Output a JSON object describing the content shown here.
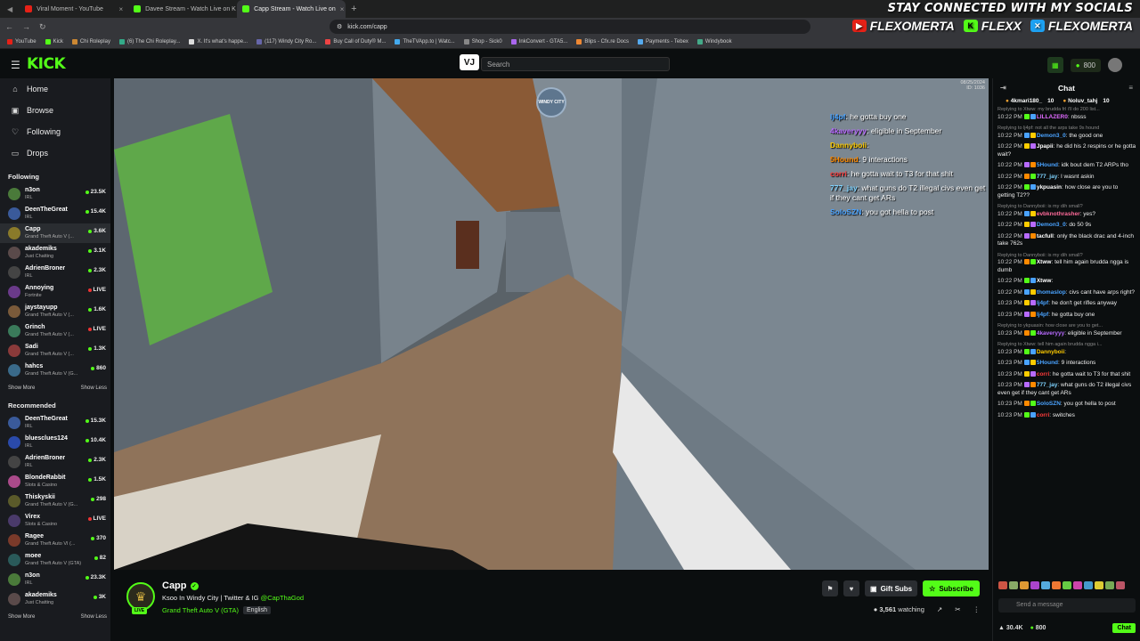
{
  "browser": {
    "tabs": [
      {
        "title": "Viral Moment - YouTube",
        "color": "#e62117"
      },
      {
        "title": "Davee Stream - Watch Live on K",
        "color": "#53fc18"
      },
      {
        "title": "Capp Stream - Watch Live on",
        "color": "#53fc18",
        "active": true
      }
    ],
    "url": "kick.com/capp",
    "bookmarks": [
      "YouTube",
      "Kick",
      "Chi Roleplay",
      "(6) The Chi Roleplay...",
      "X. It's what's happe...",
      "(117) Windy City Ro...",
      "Buy Call of Duty® M...",
      "TheTVApp.to | Watc...",
      "Shop - Sick0",
      "InkConvert - GTA5...",
      "Blips - Cfx.re Docs",
      "Payments - Tebex",
      "Windybook"
    ]
  },
  "socials_overlay": {
    "heading": "STAY CONNECTED WITH MY SOCIALS",
    "items": [
      {
        "icon": "youtube-icon",
        "handle": "FLEXOMERTA",
        "color": "#e62117"
      },
      {
        "icon": "kick-icon",
        "handle": "FLEXX",
        "color": "#53fc18"
      },
      {
        "icon": "twitter-icon",
        "handle": "FLEXOMERTA",
        "color": "#1da1f2"
      }
    ]
  },
  "kick": {
    "logo": "KICK",
    "search_placeholder": "Search",
    "vj_label": "VJ",
    "points": "800",
    "nav": [
      {
        "label": "Home",
        "icon": "home-icon"
      },
      {
        "label": "Browse",
        "icon": "browse-icon"
      },
      {
        "label": "Following",
        "icon": "heart-icon"
      },
      {
        "label": "Drops",
        "icon": "drops-icon"
      }
    ],
    "following_title": "Following",
    "following": [
      {
        "name": "n3on",
        "game": "IRL",
        "viewers": "23.5K",
        "color": "#4a7a3a"
      },
      {
        "name": "DeenTheGreat",
        "game": "IRL",
        "viewers": "15.4K",
        "color": "#3a5a9a"
      },
      {
        "name": "Capp",
        "game": "Grand Theft Auto V (...",
        "viewers": "3.6K",
        "color": "#8a7a2a",
        "active": true
      },
      {
        "name": "akademiks",
        "game": "Just Chatting",
        "viewers": "3.1K",
        "color": "#5a4a4a"
      },
      {
        "name": "AdrienBroner",
        "game": "IRL",
        "viewers": "2.3K",
        "color": "#444"
      },
      {
        "name": "Annoying",
        "game": "Fortnite",
        "viewers": "LIVE",
        "color": "#6a3a8a"
      },
      {
        "name": "jaystayupp",
        "game": "Grand Theft Auto V (...",
        "viewers": "1.6K",
        "color": "#7a5a3a"
      },
      {
        "name": "Grinch",
        "game": "Grand Theft Auto V (...",
        "viewers": "LIVE",
        "color": "#3a7a5a"
      },
      {
        "name": "Sadi",
        "game": "Grand Theft Auto V (...",
        "viewers": "1.3K",
        "color": "#8a3a3a"
      },
      {
        "name": "hahcs",
        "game": "Grand Theft Auto V (G...",
        "viewers": "860",
        "color": "#3a6a8a"
      }
    ],
    "show_more": "Show More",
    "show_less": "Show Less",
    "recommended_title": "Recommended",
    "recommended": [
      {
        "name": "DeenTheGreat",
        "game": "IRL",
        "viewers": "15.3K",
        "color": "#3a5a9a"
      },
      {
        "name": "bluesclues124",
        "game": "IRL",
        "viewers": "10.4K",
        "color": "#2a4aaa"
      },
      {
        "name": "AdrienBroner",
        "game": "IRL",
        "viewers": "2.3K",
        "color": "#444"
      },
      {
        "name": "BlondeRabbit",
        "game": "Slots & Casino",
        "viewers": "1.5K",
        "color": "#aa4a8a"
      },
      {
        "name": "Thiskyskii",
        "game": "Grand Theft Auto V (G...",
        "viewers": "298",
        "color": "#5a5a2a"
      },
      {
        "name": "Virex",
        "game": "Slots & Casino",
        "viewers": "LIVE",
        "color": "#4a3a6a"
      },
      {
        "name": "Ragee",
        "game": "Grand Theft Auto VI (...",
        "viewers": "370",
        "color": "#7a3a2a"
      },
      {
        "name": "moee",
        "game": "Grand Theft Auto V (GTA)",
        "viewers": "82",
        "color": "#2a5a5a"
      },
      {
        "name": "n3on",
        "game": "IRL",
        "viewers": "23.3K",
        "color": "#4a7a3a"
      },
      {
        "name": "akademiks",
        "game": "Just Chatting",
        "viewers": "3K",
        "color": "#5a4a4a"
      }
    ]
  },
  "video": {
    "date_watermark": "08/25/2024",
    "id_watermark": "ID: 1036",
    "windy_logo": "WINDY CITY",
    "overlay_chat": [
      {
        "user": "lj4pf",
        "text": ": he gotta buy one",
        "color": "#4aa3ff"
      },
      {
        "user": "4kaveryyy",
        "text": ": eligible in September",
        "color": "#b86bff"
      },
      {
        "user": "Dannyboii",
        "text": ":",
        "color": "#ffcc00"
      },
      {
        "user": "5Hound",
        "text": ": 9 interactions",
        "color": "#ff8a00"
      },
      {
        "user": "corri",
        "text": ": he gotta wait to T3 for that shit",
        "color": "#ff3b3b"
      },
      {
        "user": "777_jay",
        "text": ": what guns do T2 illegal civs even get if they cant get ARs",
        "color": "#7fd3ff"
      },
      {
        "user": "SoloSZN",
        "text": ": you got hella to post",
        "color": "#4aa3ff"
      }
    ]
  },
  "stream": {
    "name": "Capp",
    "title_prefix": "Ksoo In Windy City | Twitter & IG ",
    "handle": "@CapThaGod",
    "category": "Grand Theft Auto V (GTA)",
    "language": "English",
    "live_label": "LIVE",
    "gift_label": "Gift Subs",
    "subscribe_label": "Subscribe",
    "watching": "3,561",
    "watching_suffix": "watching"
  },
  "chat": {
    "title": "Chat",
    "pinned": [
      {
        "user": "4kmari180_",
        "count": "10"
      },
      {
        "user": "Noluv_tahj",
        "count": "10"
      }
    ],
    "messages": [
      {
        "reply": "Replying to Xtww: my brudda frl i'll do 200 list...",
        "time": "10:22 PM",
        "user": "LILLAZER0",
        "text": ": nbsss",
        "color": "#e06bff"
      },
      {
        "reply": "Replying to lj4pf: not all the arps take 9s hound",
        "time": "10:22 PM",
        "user": "Demon3_0",
        "text": ": the good one",
        "color": "#4aa3ff"
      },
      {
        "time": "10:22 PM",
        "user": "Jpapii",
        "text": ": he did his 2 respins or he gotta wait?",
        "color": "#fff"
      },
      {
        "time": "10:22 PM",
        "user": "5Hound",
        "text": ": idk bout dem T2 ARPs tho",
        "color": "#4aa3ff"
      },
      {
        "time": "10:22 PM",
        "user": "777_jay",
        "text": ": I wasnt askin",
        "color": "#7fd3ff"
      },
      {
        "time": "10:22 PM",
        "user": "ykpuasin",
        "text": ": how close are you to getting T2??",
        "color": "#fff"
      },
      {
        "reply": "Replying to Dannyboii: is my dih small?",
        "time": "10:22 PM",
        "user": "evbknothrasher",
        "text": ": yes?",
        "color": "#ff6b9a"
      },
      {
        "time": "10:22 PM",
        "user": "Demon3_0",
        "text": ": do 50 9s",
        "color": "#4aa3ff"
      },
      {
        "time": "10:22 PM",
        "user": "tacfull",
        "text": ": only the black drac and 4-inch take 762s",
        "color": "#fff"
      },
      {
        "reply": "Replying to Dannyboii: is my dih small?",
        "time": "10:22 PM",
        "user": "Xtww",
        "text": ": tell him again brudda ngga is dumb",
        "color": "#fff"
      },
      {
        "time": "10:22 PM",
        "user": "Xtww",
        "text": ":",
        "color": "#fff"
      },
      {
        "time": "10:22 PM",
        "user": "thomaslop",
        "text": ": civs cant have arps right?",
        "color": "#4aa3ff"
      },
      {
        "time": "10:23 PM",
        "user": "lj4pf",
        "text": ": he don't get rifles anyway",
        "color": "#4aa3ff"
      },
      {
        "time": "10:23 PM",
        "user": "lj4pf",
        "text": ": he gotta buy one",
        "color": "#4aa3ff"
      },
      {
        "reply": "Replying to ykpuasin: how close are you to get...",
        "time": "10:23 PM",
        "user": "4kaveryyy",
        "text": ": eligible in September",
        "color": "#b86bff"
      },
      {
        "reply": "Replying to Xtww: tell him again brudda ngga i...",
        "time": "10:23 PM",
        "user": "Dannyboii",
        "text": ":",
        "color": "#ffcc00"
      },
      {
        "time": "10:23 PM",
        "user": "5Hound",
        "text": ": 9 interactions",
        "color": "#4aa3ff"
      },
      {
        "time": "10:23 PM",
        "user": "corri",
        "text": ": he gotta wait to T3 for that shit",
        "color": "#ff3b3b"
      },
      {
        "time": "10:23 PM",
        "user": "777_jay",
        "text": ": what guns do T2 illegal civs even get if they cant get ARs",
        "color": "#7fd3ff"
      },
      {
        "time": "10:23 PM",
        "user": "SoloSZN",
        "text": ": you got hella to post",
        "color": "#4aa3ff"
      },
      {
        "time": "10:23 PM",
        "user": "corri",
        "text": ": switches",
        "color": "#ff3b3b"
      }
    ],
    "input_placeholder": "Send a message",
    "followers": "30.4K",
    "points": "800",
    "send_label": "Chat"
  }
}
